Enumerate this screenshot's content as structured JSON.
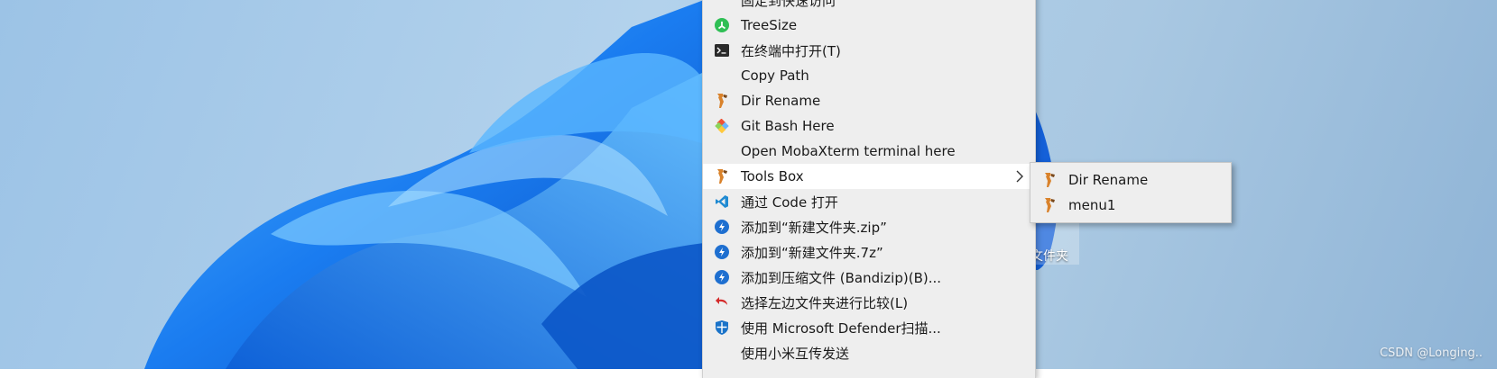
{
  "desktop": {
    "folder_label": "文件夹",
    "watermark": "CSDN @Longing.."
  },
  "context_menu": {
    "items": [
      {
        "label": "固定到快速访问",
        "icon": "pin-icon"
      },
      {
        "label": "TreeSize",
        "icon": "treesize-icon"
      },
      {
        "label": "在终端中打开(T)",
        "icon": "terminal-icon"
      },
      {
        "label": "Copy Path",
        "icon": ""
      },
      {
        "label": "Dir Rename",
        "icon": "tool-icon"
      },
      {
        "label": "Git Bash Here",
        "icon": "git-icon"
      },
      {
        "label": "Open MobaXterm terminal here",
        "icon": ""
      },
      {
        "label": "Tools Box",
        "icon": "tool-icon",
        "has_submenu": true
      },
      {
        "label": "通过 Code 打开",
        "icon": "vscode-icon"
      },
      {
        "label": "添加到“新建文件夹.zip”",
        "icon": "bandizip-icon"
      },
      {
        "label": "添加到“新建文件夹.7z”",
        "icon": "bandizip-icon"
      },
      {
        "label": "添加到压缩文件 (Bandizip)(B)...",
        "icon": "bandizip-icon"
      },
      {
        "label": "选择左边文件夹进行比较(L)",
        "icon": "compare-icon"
      },
      {
        "label": "使用 Microsoft Defender扫描...",
        "icon": "defender-icon"
      },
      {
        "label": "使用小米互传发送",
        "icon": ""
      }
    ]
  },
  "submenu": {
    "items": [
      {
        "label": "Dir Rename",
        "icon": "tool-icon"
      },
      {
        "label": "menu1",
        "icon": "tool-icon"
      }
    ]
  },
  "colors": {
    "menu_bg": "#eeeeee",
    "hover_bg": "#ffffff",
    "wallpaper_blue": "#1a8cff",
    "treesize_green": "#2fbf55",
    "bandizip_blue": "#1e6fd0",
    "vscode_blue": "#1f8ad2"
  }
}
